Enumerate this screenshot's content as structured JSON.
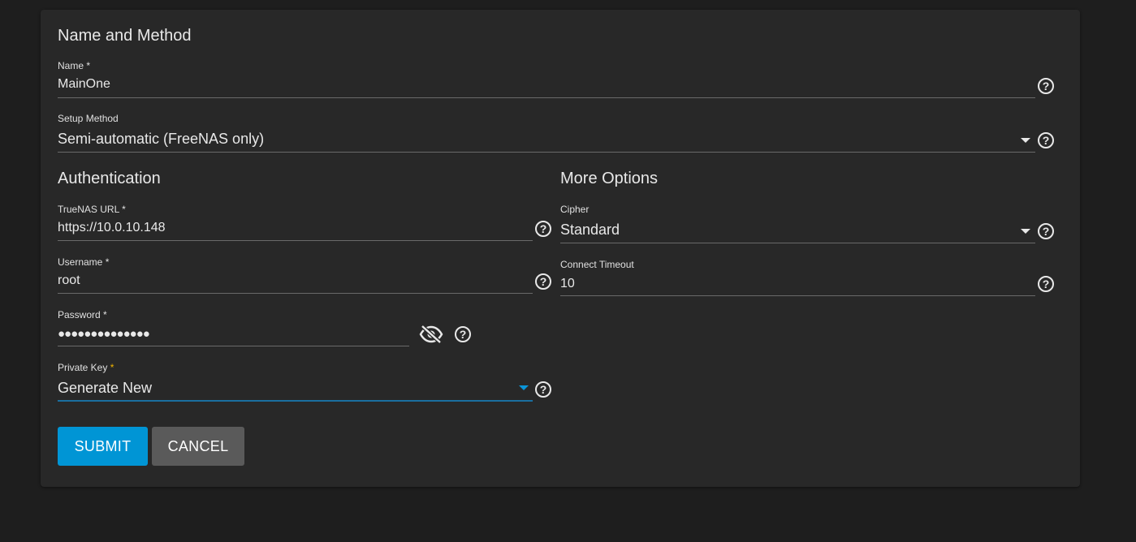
{
  "sections": {
    "name_method": "Name and Method",
    "authentication": "Authentication",
    "more_options": "More Options"
  },
  "fields": {
    "name": {
      "label": "Name",
      "required_mark": "*",
      "value": "MainOne"
    },
    "setup_method": {
      "label": "Setup Method",
      "value": "Semi-automatic (FreeNAS only)"
    },
    "truenas_url": {
      "label": "TrueNAS URL",
      "required_mark": "*",
      "value": "https://10.0.10.148"
    },
    "username": {
      "label": "Username",
      "required_mark": "*",
      "value": "root"
    },
    "password": {
      "label": "Password",
      "required_mark": "*",
      "value": "●●●●●●●●●●●●●●"
    },
    "private_key": {
      "label": "Private Key",
      "required_mark": "*",
      "value": "Generate New"
    },
    "cipher": {
      "label": "Cipher",
      "value": "Standard"
    },
    "connect_timeout": {
      "label": "Connect Timeout",
      "value": "10"
    }
  },
  "icons": {
    "help": "?",
    "visibility_off": "eye-off-icon",
    "dropdown": "chevron-down-icon"
  },
  "buttons": {
    "submit": "SUBMIT",
    "cancel": "CANCEL"
  },
  "colors": {
    "background": "#1e1e1e",
    "card": "#282828",
    "primary": "#0095d5",
    "focus_underline": "#1a6fa0",
    "required_accent": "#f0b400",
    "cancel": "#5a5a5a"
  }
}
